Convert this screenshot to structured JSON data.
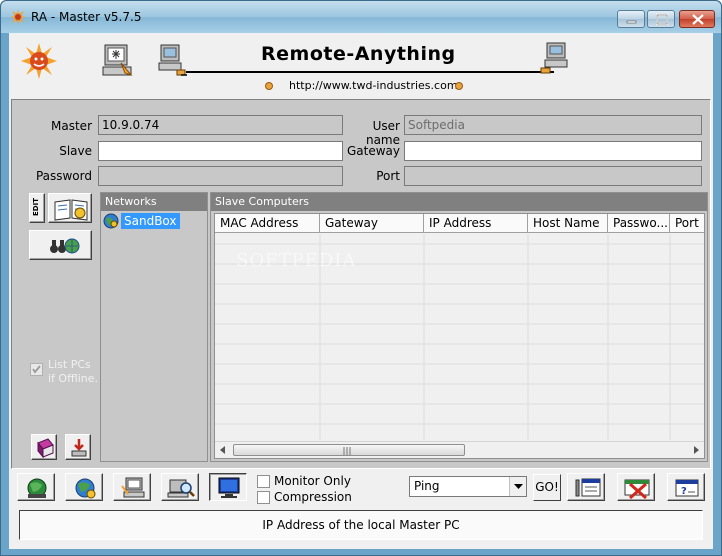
{
  "window": {
    "title": "RA - Master v5.7.5"
  },
  "header": {
    "brand": "Remote-Anything",
    "url": "http://www.twd-industries.com"
  },
  "form": {
    "master_label": "Master",
    "master_value": "10.9.0.74",
    "slave_label": "Slave",
    "slave_value": "",
    "password_label": "Password",
    "password_value": "",
    "username_label": "User name",
    "username_value": "Softpedia",
    "gateway_label": "Gateway",
    "gateway_value": "",
    "port_label": "Port",
    "port_value": ""
  },
  "side_tools": {
    "edit_label": "EDIT",
    "list_offline_label_1": "List PCs",
    "list_offline_label_2": "if Offline."
  },
  "networks": {
    "heading": "Networks",
    "items": [
      "SandBox"
    ]
  },
  "slaves": {
    "heading": "Slave Computers",
    "columns": [
      "MAC Address",
      "Gateway",
      "IP Address",
      "Host Name",
      "Passwo...",
      "Port"
    ]
  },
  "watermark": "SOFTPEDIA",
  "bottom": {
    "monitor_only_label": "Monitor Only",
    "compression_label": "Compression",
    "ping_selected": "Ping",
    "go_label": "GO!"
  },
  "status": {
    "text": "IP Address of the local Master PC"
  }
}
